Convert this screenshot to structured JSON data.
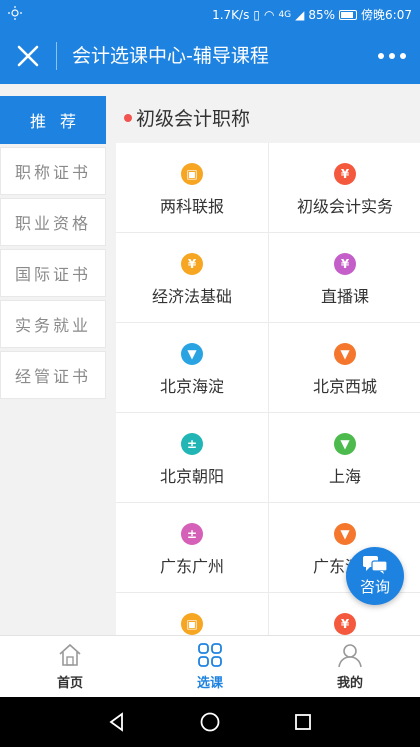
{
  "statusbar": {
    "speed": "1.7K/s",
    "signal": "4G",
    "battery": "85%",
    "time": "傍晚6:07"
  },
  "header": {
    "title": "会计选课中心-辅导课程"
  },
  "sidebar": {
    "items": [
      {
        "label": "推荐",
        "active": true
      },
      {
        "label": "职称证书"
      },
      {
        "label": "职业资格"
      },
      {
        "label": "国际证书"
      },
      {
        "label": "实务就业"
      },
      {
        "label": "经管证书"
      }
    ]
  },
  "section": {
    "title": "初级会计职称"
  },
  "grid": {
    "cells": [
      {
        "label": "两科联报",
        "icon": "briefcase-icon",
        "color": "#f6a623"
      },
      {
        "label": "初级会计实务",
        "icon": "yuan-icon",
        "color": "#f5593d"
      },
      {
        "label": "经济法基础",
        "icon": "yuan-icon",
        "color": "#f6a623"
      },
      {
        "label": "直播课",
        "icon": "yuan-icon",
        "color": "#c45ec8"
      },
      {
        "label": "北京海淀",
        "icon": "tie-icon",
        "color": "#2aa3e3"
      },
      {
        "label": "北京西城",
        "icon": "tie-icon",
        "color": "#f5772d"
      },
      {
        "label": "北京朝阳",
        "icon": "calculator-icon",
        "color": "#22b5b5"
      },
      {
        "label": "上海",
        "icon": "tie-icon",
        "color": "#4cba4c"
      },
      {
        "label": "广东广州",
        "icon": "calculator-icon",
        "color": "#d460b8"
      },
      {
        "label": "广东深圳",
        "icon": "tie-icon",
        "color": "#f5772d"
      },
      {
        "label": "",
        "icon": "briefcase-icon",
        "color": "#f6a623"
      },
      {
        "label": "",
        "icon": "yuan-icon",
        "color": "#f5593d"
      }
    ]
  },
  "consult": {
    "label": "咨询"
  },
  "tabbar": {
    "tabs": [
      {
        "label": "首页",
        "icon": "home-icon"
      },
      {
        "label": "选课",
        "icon": "grid-icon",
        "active": true
      },
      {
        "label": "我的",
        "icon": "user-icon"
      }
    ]
  },
  "colors": {
    "primary": "#1e82e0",
    "accent_dot": "#f25450"
  }
}
